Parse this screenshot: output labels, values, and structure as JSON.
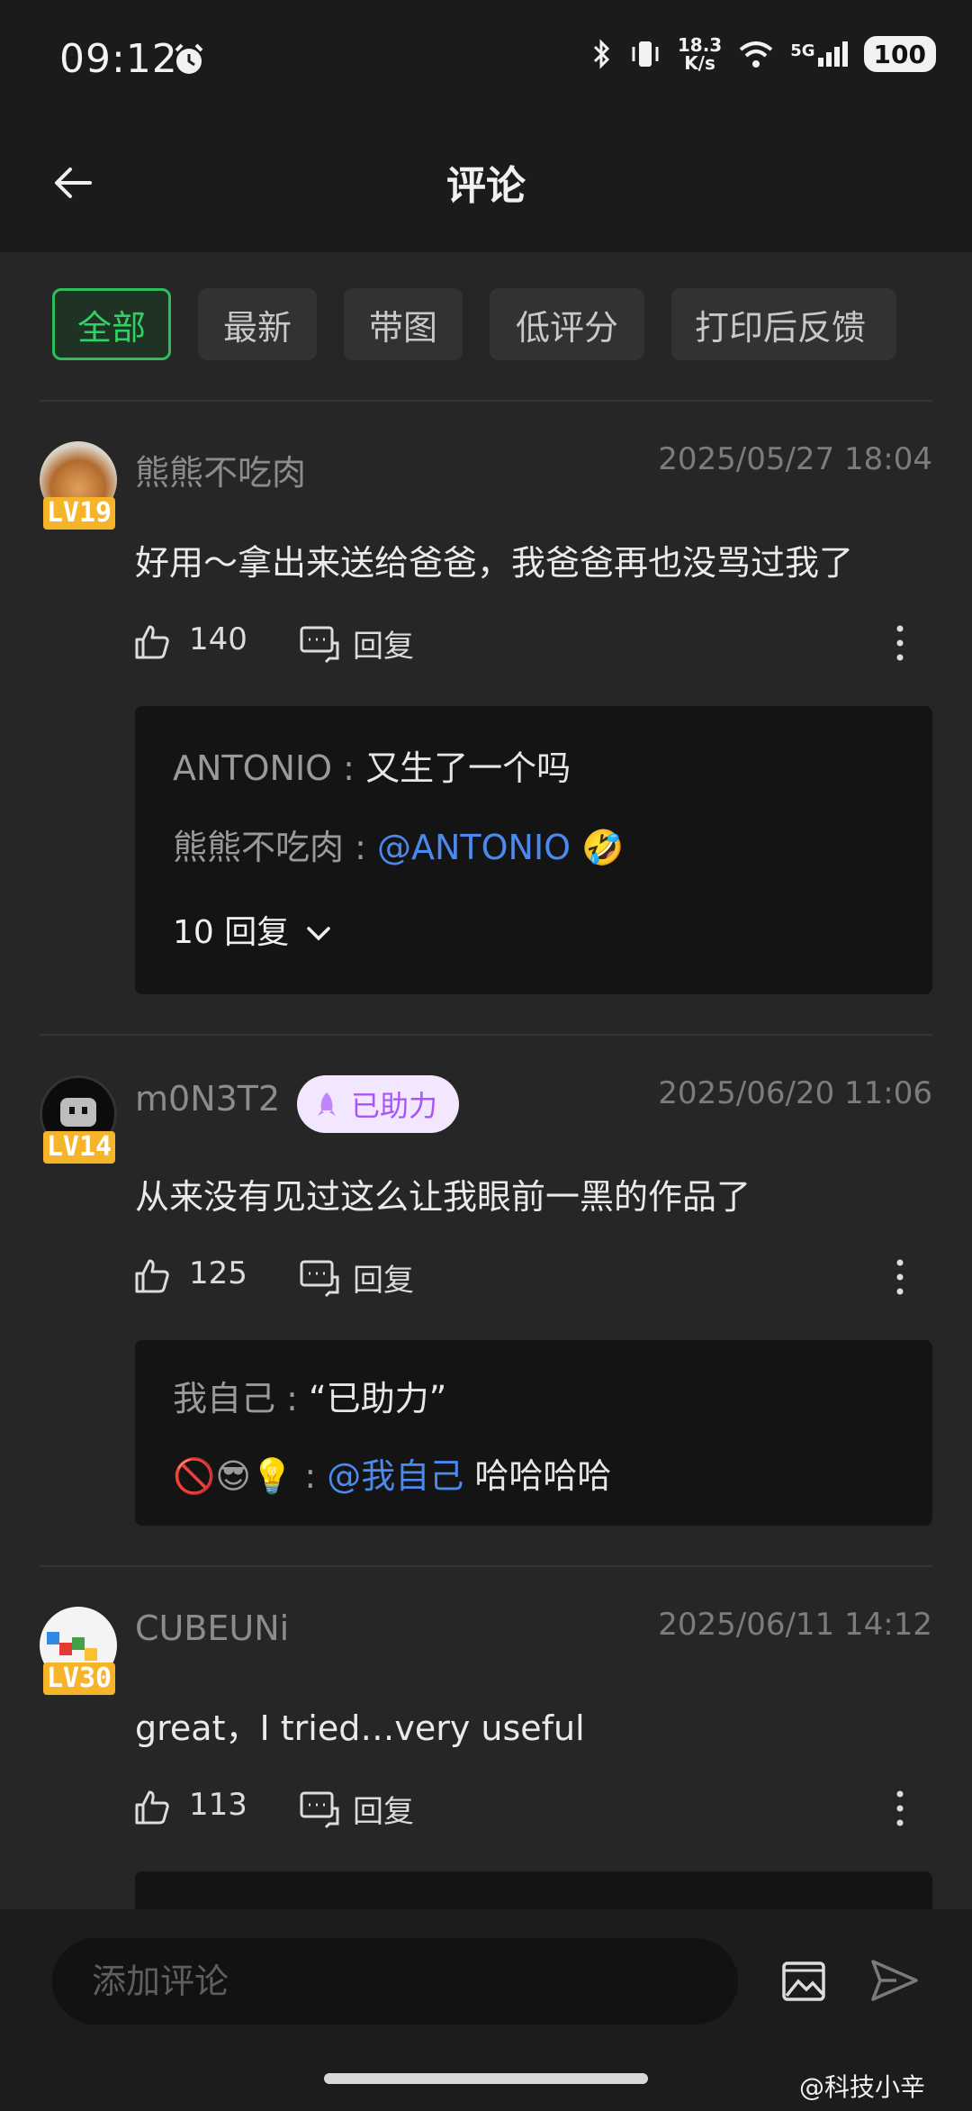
{
  "status_bar": {
    "time": "09:12",
    "net_speed_value": "18.3",
    "net_speed_unit": "K/s",
    "network": "5G",
    "battery": "100"
  },
  "header": {
    "title": "评论"
  },
  "tabs": [
    {
      "label": "全部",
      "active": true
    },
    {
      "label": "最新",
      "active": false
    },
    {
      "label": "带图",
      "active": false
    },
    {
      "label": "低评分",
      "active": false
    },
    {
      "label": "打印后反馈",
      "active": false
    }
  ],
  "comments": [
    {
      "user": "熊熊不吃肉",
      "level": "LV19",
      "date": "2025/05/27 18:04",
      "text": "好用～拿出来送给爸爸，我爸爸再也没骂过我了",
      "likes": "140",
      "reply_label": "回复",
      "replies": [
        {
          "name": "ANTONIO",
          "sep": " : ",
          "text": "又生了一个吗"
        },
        {
          "name": "熊熊不吃肉",
          "sep": " : ",
          "mention": "@ANTONIO",
          "text": " 🤣"
        }
      ],
      "more_replies": "10 回复"
    },
    {
      "user": "m0N3T2",
      "level": "LV14",
      "badge": "已助力",
      "date": "2025/06/20 11:06",
      "text": "从来没有见过这么让我眼前一黑的作品了",
      "likes": "125",
      "reply_label": "回复",
      "replies": [
        {
          "name": "我自己",
          "sep": " : ",
          "text": "“已助力”"
        },
        {
          "name": "🚫😎💡",
          "sep": " : ",
          "mention": "@我自己",
          "text": " 哈哈哈哈"
        }
      ]
    },
    {
      "user": "CUBEUNi",
      "level": "LV30",
      "date": "2025/06/11 14:12",
      "text": "great，I tried…very useful",
      "likes": "113",
      "reply_label": "回复"
    }
  ],
  "bottom_bar": {
    "placeholder": "添加评论"
  },
  "watermark": "@科技小辛",
  "colors": {
    "accent": "#2fbd5a",
    "mention": "#4a8af0",
    "level_badge": "#f5b42a",
    "badge_purple": "#a855f7"
  }
}
